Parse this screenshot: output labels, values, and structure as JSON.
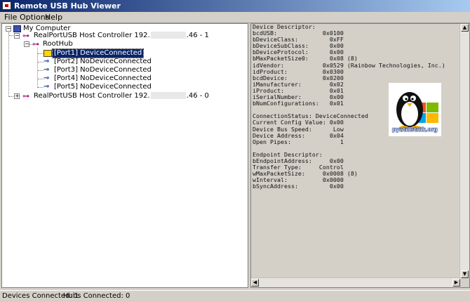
{
  "window": {
    "title": "Remote USB Hub Viewer"
  },
  "menu": {
    "file": "File",
    "options": "Options",
    "help": "Help"
  },
  "tree": {
    "root": "My Computer",
    "controller1": {
      "prefix": "RealPortUSB Host Controller 192.",
      "suffix": ".46 - 1"
    },
    "roothub": "RootHub",
    "ports": [
      "[Port1] DeviceConnected",
      "[Port2] NoDeviceConnected",
      "[Port3] NoDeviceConnected",
      "[Port4] NoDeviceConnected",
      "[Port5] NoDeviceConnected"
    ],
    "controller2": {
      "prefix": "RealPortUSB Host Controller 192.",
      "suffix": ".46 - 0"
    }
  },
  "details": {
    "text": "Device Descriptor:\nbcdUSB:             0x0100\nbDeviceClass:         0xFF\nbDeviceSubClass:      0x00\nbDeviceProtocol:      0x00\nbMaxPacketSize0:      0x08 (8)\nidVendor:           0x0529 (Rainbow Technologies, Inc.)\nidProduct:          0x0300\nbcdDevice:          0x0200\niManufacturer:        0x02\niProduct:             0x01\niSerialNumber:        0x00\nbNumConfigurations:   0x01\n\nConnectionStatus: DeviceConnected\nCurrent Config Value: 0x00\nDevice Bus Speed:      Low\nDevice Address:       0x04\nOpen Pipes:              1\n\nEndpoint Descriptor:\nbEndpointAddress:     0x00\nTransfer Type:     Control\nwMaxPacketSize:     0x0008 (8)\nwInterval:          0x0000\nbSyncAddress:         0x00",
    "watermark": "pyatilistnik.org"
  },
  "status": {
    "devices": "Devices Connected: 1",
    "hubs": "Hubs Connected: 0"
  },
  "colors": {
    "titlebar_start": "#0a246a",
    "titlebar_end": "#a6caf0",
    "selection": "#0a246a",
    "chrome": "#d4d0c8"
  }
}
